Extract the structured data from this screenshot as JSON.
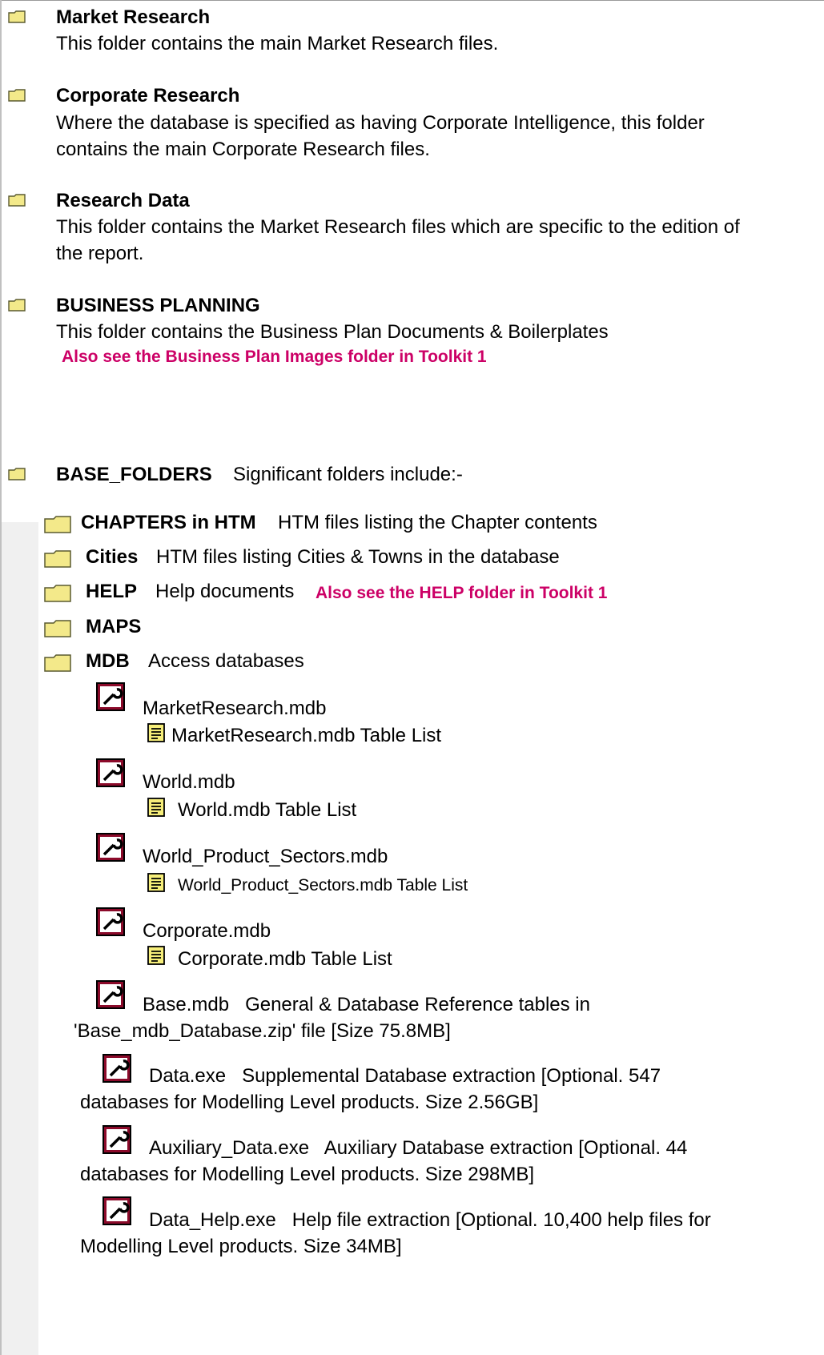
{
  "top_folders": [
    {
      "title": "Market Research",
      "desc": [
        "This folder contains the main Market Research files."
      ]
    },
    {
      "title": "Corporate Research",
      "desc": [
        "Where the database is specified as having Corporate Intelligence, this folder",
        "contains the main Corporate Research files."
      ]
    },
    {
      "title": "Research Data",
      "desc": [
        "This folder contains the Market Research files which are specific to the edition of",
        "the report."
      ]
    },
    {
      "title": "BUSINESS PLANNING",
      "desc": [
        "This folder contains the Business Plan Documents & Boilerplates"
      ],
      "note": "Also see the Business Plan Images folder in Toolkit 1"
    }
  ],
  "base_folders": {
    "title": "BASE_FOLDERS",
    "desc": "Significant folders include:-"
  },
  "subfolders": [
    {
      "name": "CHAPTERS in HTM",
      "desc": "HTM files listing the Chapter contents"
    },
    {
      "name": "Cities",
      "desc": "HTM files listing Cities & Towns in the database"
    },
    {
      "name": "HELP",
      "desc": "Help documents",
      "note": "Also see the HELP folder in Toolkit 1"
    },
    {
      "name": "MAPS",
      "desc": ""
    },
    {
      "name": "MDB",
      "desc": "Access databases"
    }
  ],
  "databases": [
    {
      "name": "MarketResearch.mdb",
      "table_list": "MarketResearch.mdb Table List"
    },
    {
      "name": "World.mdb",
      "table_list": "World.mdb Table List"
    },
    {
      "name": "World_Product_Sectors.mdb",
      "table_list": "World_Product_Sectors.mdb Table List"
    },
    {
      "name": "Corporate.mdb",
      "table_list": "Corporate.mdb Table List"
    }
  ],
  "extras": [
    {
      "line1": "Base.mdb   General & Database Reference tables in",
      "line2": "'Base_mdb_Database.zip' file [Size 75.8MB]"
    },
    {
      "line1": "Data.exe   Supplemental Database extraction [Optional. 547",
      "line2": "databases for Modelling Level products. Size 2.56GB]"
    },
    {
      "line1": "Auxiliary_Data.exe   Auxiliary Database extraction [Optional. 44",
      "line2": "databases for Modelling Level products. Size 298MB]"
    },
    {
      "line1": "Data_Help.exe   Help file extraction [Optional. 10,400 help files for",
      "line2": "Modelling Level products. Size 34MB]"
    }
  ],
  "colors": {
    "accent_note": "#cc0066",
    "folder_fill": "#f3e98a",
    "access_icon": "#8b0a2a"
  }
}
